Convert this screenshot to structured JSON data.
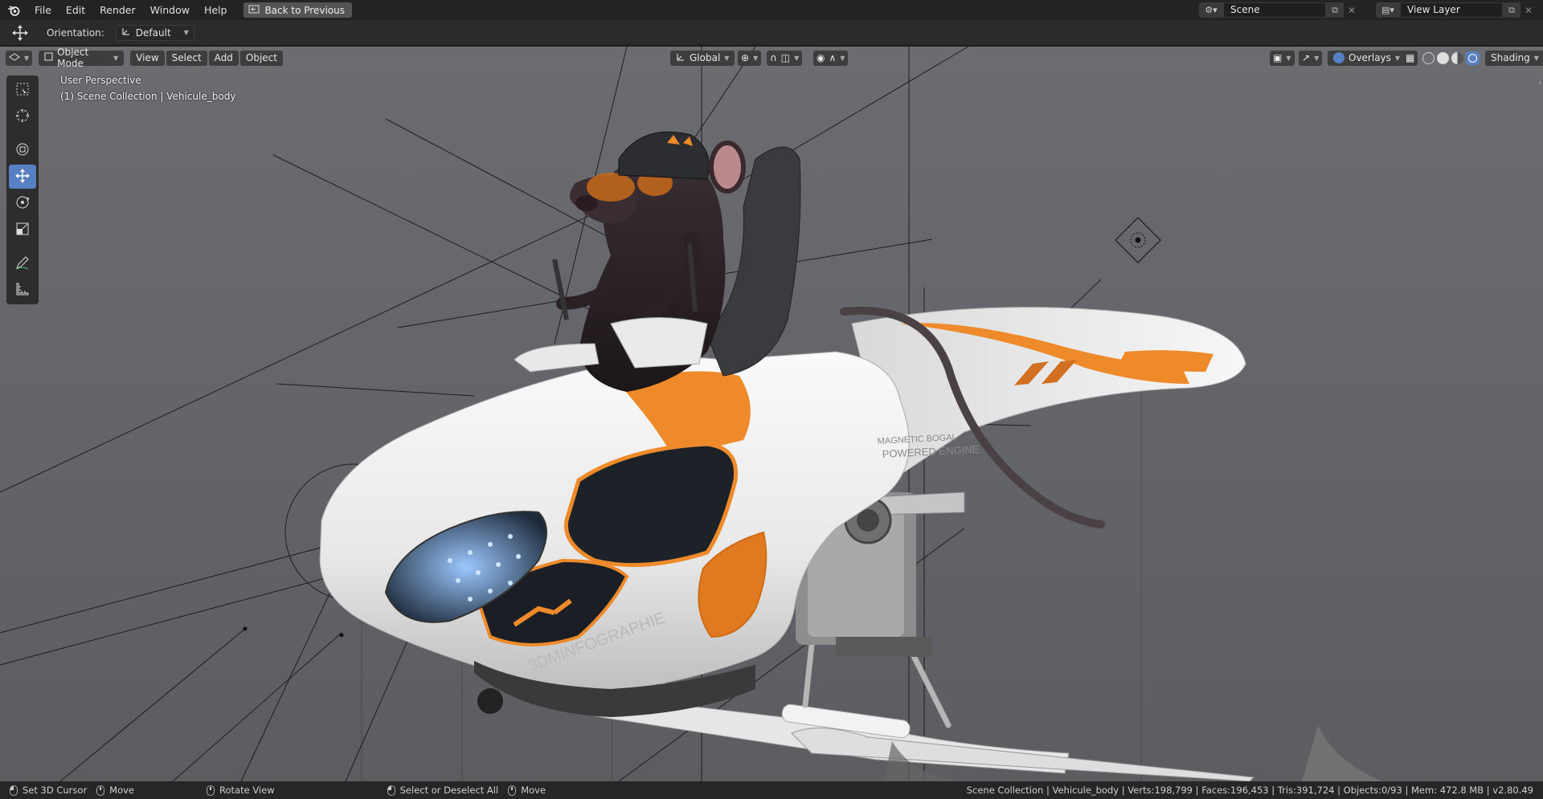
{
  "topbar": {
    "menus": [
      "File",
      "Edit",
      "Render",
      "Window",
      "Help"
    ],
    "back_button": "Back to Previous",
    "scene": "Scene",
    "view_layer": "View Layer"
  },
  "toolheader": {
    "orientation_label": "Orientation:",
    "orientation_value": "Default"
  },
  "viewport": {
    "mode": "Object Mode",
    "menus": [
      "View",
      "Select",
      "Add",
      "Object"
    ],
    "transform_orientation": "Global",
    "overlays": "Overlays",
    "shading": "Shading",
    "info_line1": "User Perspective",
    "info_line2": "(1) Scene Collection | Vehicule_body"
  },
  "model_text": {
    "brand": "3DMINFOGRAPHIE",
    "engine_line1": "MAGNETIC BOGAL",
    "engine_line2": "POWERED ENGINE"
  },
  "statusbar": {
    "items": [
      {
        "mouse": "l",
        "label": "Set 3D Cursor"
      },
      {
        "mouse": "m",
        "label": "Move"
      },
      {
        "mouse": "m",
        "label": "Rotate View"
      },
      {
        "mouse": "l",
        "label": "Select or Deselect All"
      },
      {
        "mouse": "m",
        "label": "Move"
      }
    ],
    "stats": "Scene Collection | Vehicule_body | Verts:198,799 | Faces:196,453 | Tris:391,724 | Objects:0/93 | Mem: 472.8 MB | v2.80.49"
  },
  "colors": {
    "accent": "#5680c2",
    "orange": "#ee8a2a",
    "body_white": "#f2f2f2"
  }
}
